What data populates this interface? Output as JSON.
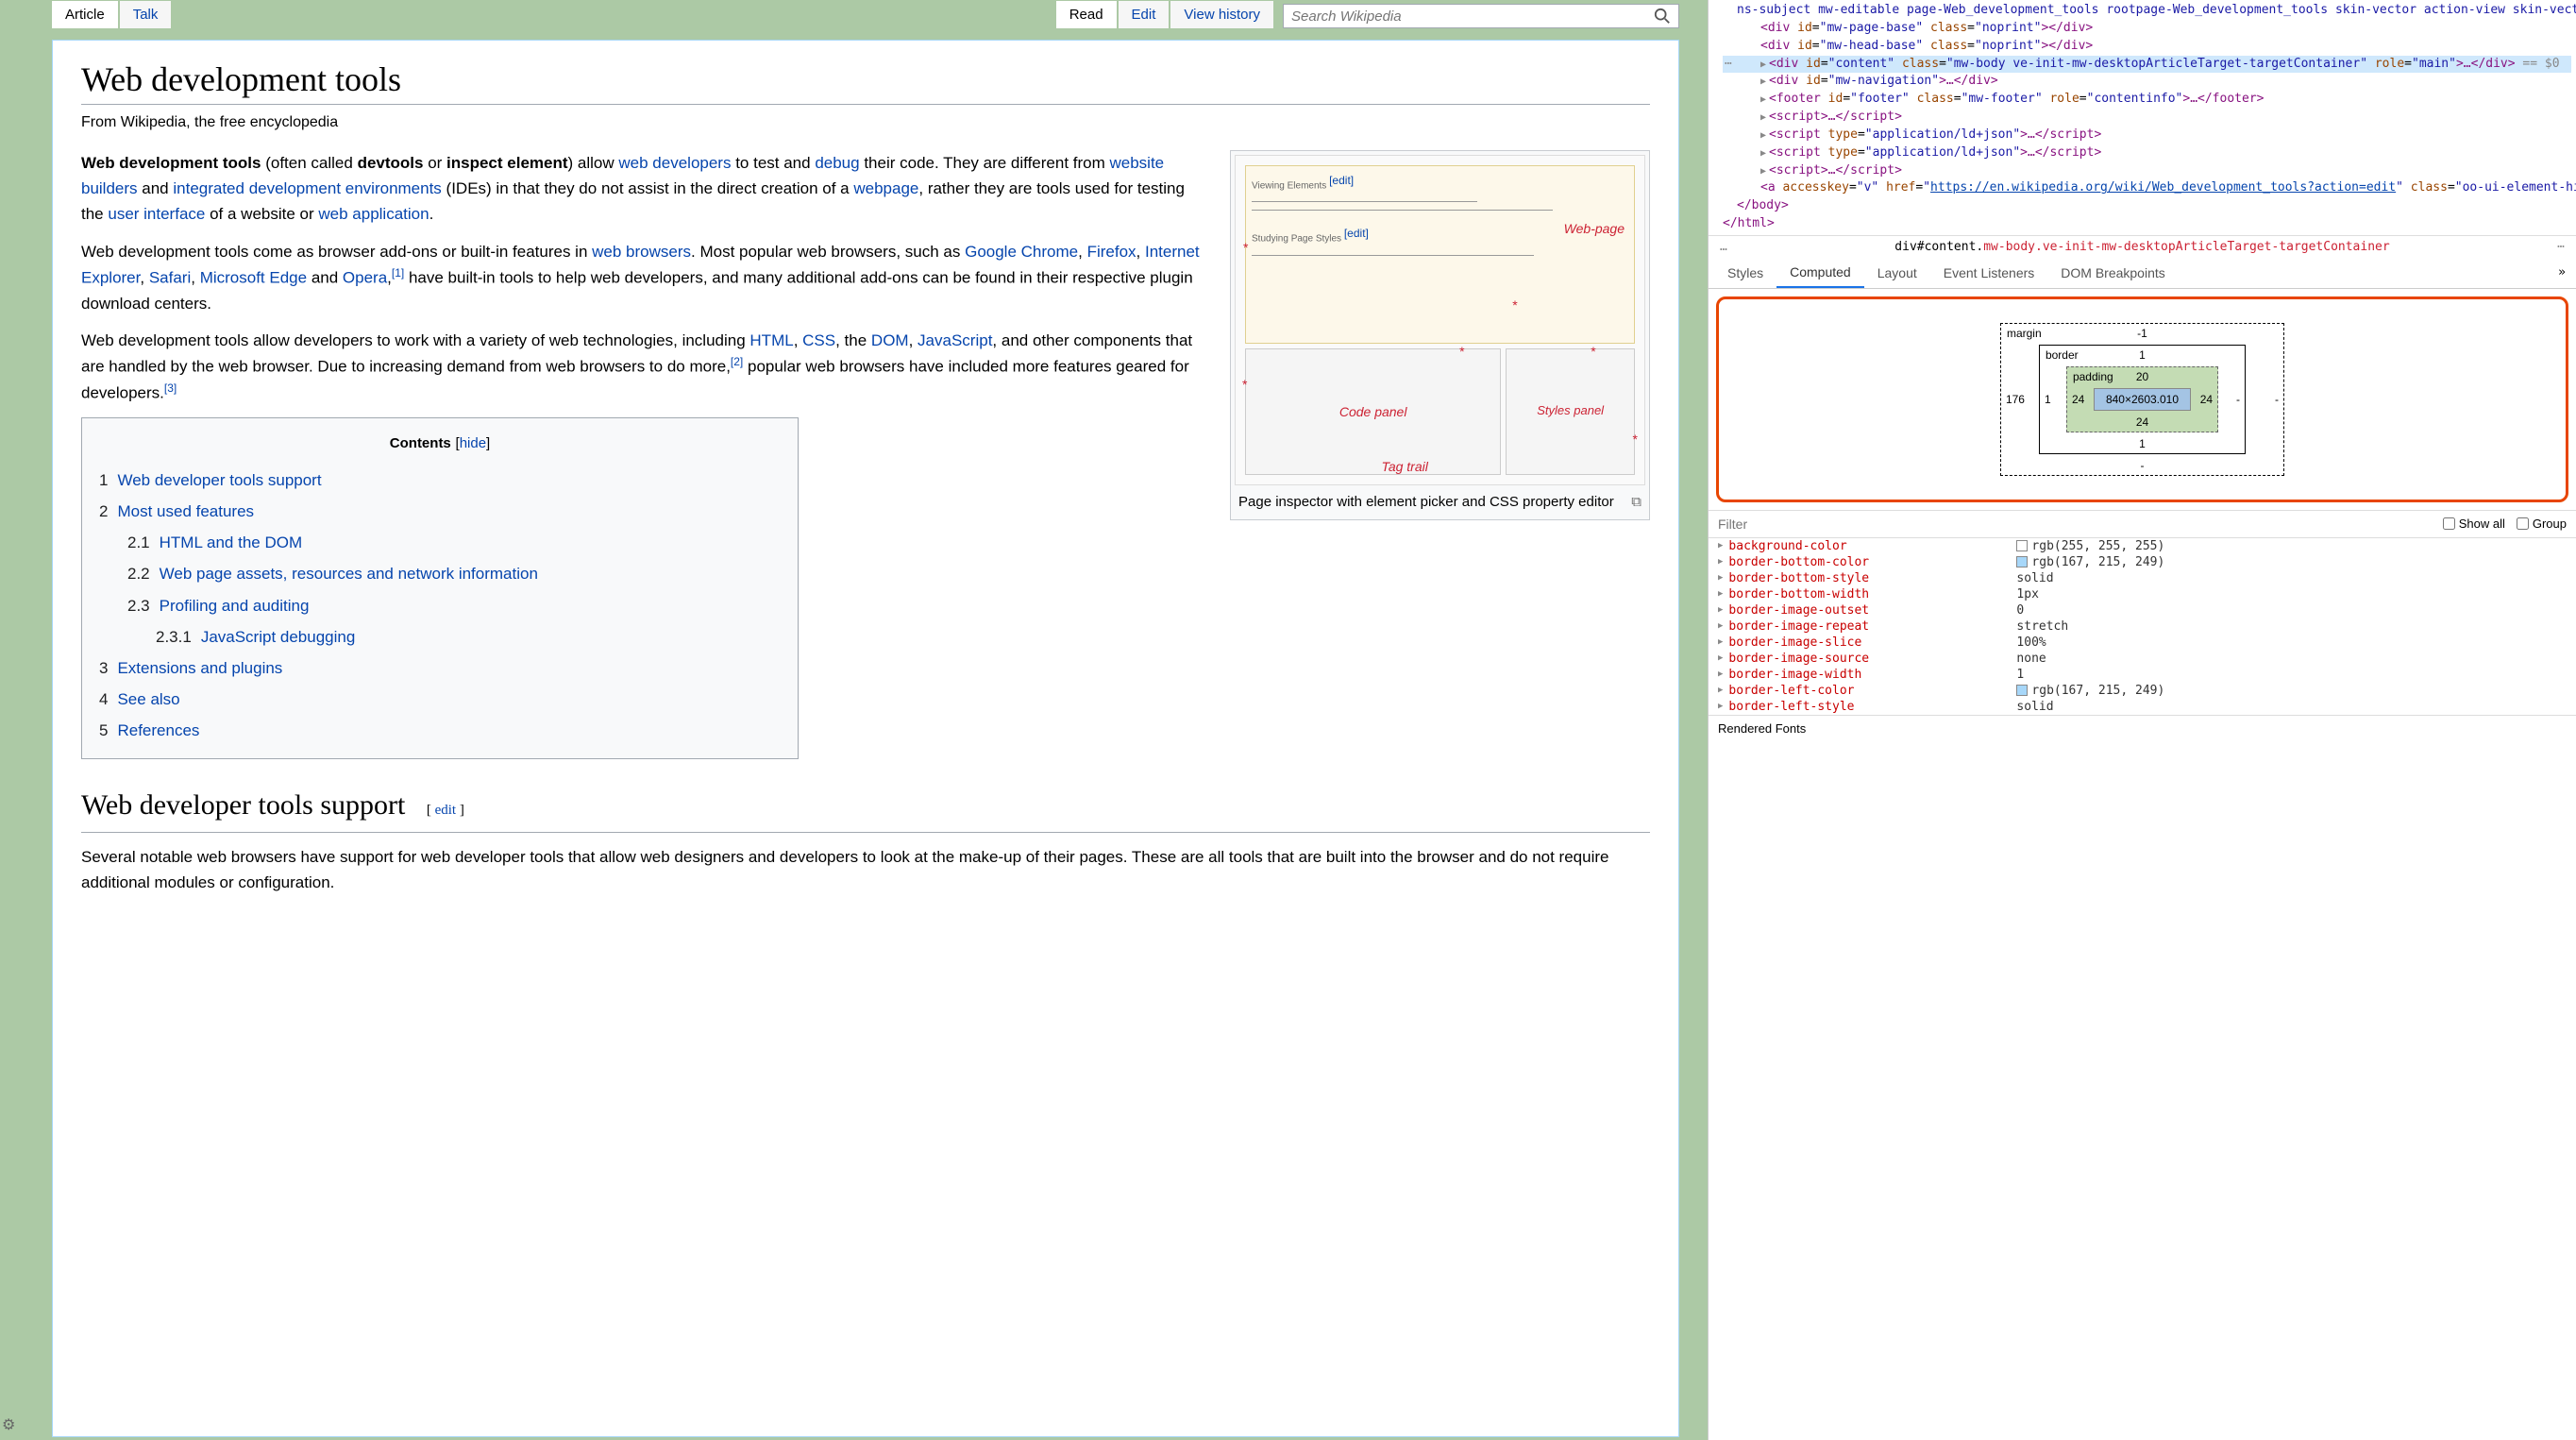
{
  "tabs_left": [
    "Article",
    "Talk"
  ],
  "tabs_right": [
    "Read",
    "Edit",
    "View history"
  ],
  "search_placeholder": "Search Wikipedia",
  "title": "Web development tools",
  "subtitle": "From Wikipedia, the free encyclopedia",
  "thumb": {
    "label_webpage": "Web-page",
    "label_code": "Code panel",
    "label_styles": "Styles panel",
    "label_tag": "Tag trail",
    "caption": "Page inspector with element picker and CSS property editor"
  },
  "p1_parts": {
    "b1": "Web development tools",
    "t1": " (often called ",
    "b2": "devtools",
    "t2": " or ",
    "b3": "inspect element",
    "t3": ") allow ",
    "a1": "web developers",
    "t4": " to test and ",
    "a2": "debug",
    "t5": " their code. They are different from ",
    "a3": "website builders",
    "t6": " and ",
    "a4": "integrated development environments",
    "t7": " (IDEs) in that they do not assist in the direct creation of a ",
    "a5": "webpage",
    "t8": ", rather they are tools used for testing the ",
    "a6": "user interface",
    "t9": " of a website or ",
    "a7": "web application",
    "t10": "."
  },
  "p2_parts": {
    "t1": "Web development tools come as browser add-ons or built-in features in ",
    "a1": "web browsers",
    "t2": ". Most popular web browsers, such as ",
    "a2": "Google Chrome",
    "a3": "Firefox",
    "a4": "Internet Explorer",
    "a5": "Safari",
    "a6": "Microsoft Edge",
    "t3": " and ",
    "a7": "Opera",
    "s1": "[1]",
    "t4": " have built-in tools to help web developers, and many additional add-ons can be found in their respective plugin download centers."
  },
  "p3_parts": {
    "t1": "Web development tools allow developers to work with a variety of web technologies, including ",
    "a1": "HTML",
    "a2": "CSS",
    "t2": ", the ",
    "a3": "DOM",
    "a4": "JavaScript",
    "t3": ", and other components that are handled by the web browser. Due to increasing demand from web browsers to do more,",
    "s1": "[2]",
    "t4": " popular web browsers have included more features geared for developers.",
    "s2": "[3]"
  },
  "toc": {
    "title": "Contents",
    "hide": "hide",
    "items": [
      {
        "n": "1",
        "t": "Web developer tools support",
        "c": ""
      },
      {
        "n": "2",
        "t": "Most used features",
        "c": ""
      },
      {
        "n": "2.1",
        "t": "HTML and the DOM",
        "c": "sub"
      },
      {
        "n": "2.2",
        "t": "Web page assets, resources and network information",
        "c": "sub"
      },
      {
        "n": "2.3",
        "t": "Profiling and auditing",
        "c": "sub"
      },
      {
        "n": "2.3.1",
        "t": "JavaScript debugging",
        "c": "sub2"
      },
      {
        "n": "3",
        "t": "Extensions and plugins",
        "c": ""
      },
      {
        "n": "4",
        "t": "See also",
        "c": ""
      },
      {
        "n": "5",
        "t": "References",
        "c": ""
      }
    ]
  },
  "h2": {
    "text": "Web developer tools support",
    "edit": "edit"
  },
  "p4": "Several notable web browsers have support for web developer tools that allow web designers and developers to look at the make-up of their pages. These are all tools that are built into the browser and do not require additional modules or configuration.",
  "dom_frag": "ns-subject mw-editable page-Web_development_tools rootpage-Web_development_tools skin-vector action-view skin-vector-legacy",
  "dom_url": "https://en.wikipedia.org/wiki/Web_development_tools?action=edit",
  "breadcrumb": {
    "pre": "div#content.",
    "sel": "mw-body.ve-init-mw-desktopArticleTarget-targetContainer"
  },
  "dt_tabs": [
    "Styles",
    "Computed",
    "Layout",
    "Event Listeners",
    "DOM Breakpoints"
  ],
  "box": {
    "margin": "margin",
    "mt": "-1",
    "mb": "-",
    "ml": "176",
    "mr": "-",
    "border": "border",
    "bt": "1",
    "bb": "1",
    "bl": "1",
    "br": "-",
    "padding": "padding",
    "pt": "20",
    "pb": "24",
    "pl": "24",
    "pr": "24",
    "content": "840×2603.010"
  },
  "filter": {
    "placeholder": "Filter",
    "showall": "Show all",
    "group": "Group"
  },
  "props": [
    {
      "n": "background-color",
      "v": "rgb(255, 255, 255)",
      "c": "#ffffff"
    },
    {
      "n": "border-bottom-color",
      "v": "rgb(167, 215, 249)",
      "c": "#a7d7f9"
    },
    {
      "n": "border-bottom-style",
      "v": "solid"
    },
    {
      "n": "border-bottom-width",
      "v": "1px"
    },
    {
      "n": "border-image-outset",
      "v": "0"
    },
    {
      "n": "border-image-repeat",
      "v": "stretch"
    },
    {
      "n": "border-image-slice",
      "v": "100%"
    },
    {
      "n": "border-image-source",
      "v": "none"
    },
    {
      "n": "border-image-width",
      "v": "1"
    },
    {
      "n": "border-left-color",
      "v": "rgb(167, 215, 249)",
      "c": "#a7d7f9"
    },
    {
      "n": "border-left-style",
      "v": "solid"
    }
  ],
  "rendered_fonts": "Rendered Fonts"
}
